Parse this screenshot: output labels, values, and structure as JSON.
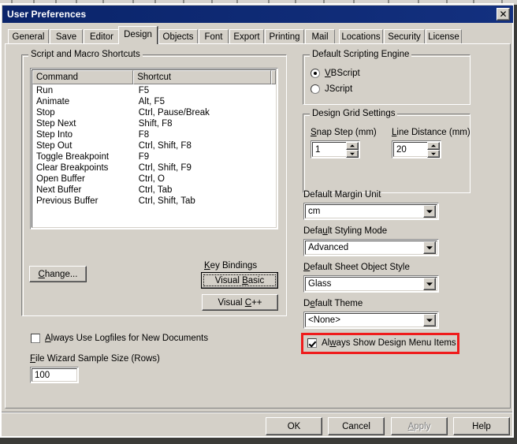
{
  "window": {
    "title": "User Preferences",
    "close_label": "✕",
    "titlebar_color": "#0a246a",
    "face_color": "#d4d0c8"
  },
  "tabs": [
    {
      "label": "General",
      "active": false
    },
    {
      "label": "Save",
      "active": false
    },
    {
      "label": "Editor",
      "active": false
    },
    {
      "label": "Design",
      "active": true
    },
    {
      "label": "Objects",
      "active": false
    },
    {
      "label": "Font",
      "active": false
    },
    {
      "label": "Export",
      "active": false
    },
    {
      "label": "Printing",
      "active": false
    },
    {
      "label": "Mail",
      "active": false
    },
    {
      "label": "Locations",
      "active": false
    },
    {
      "label": "Security",
      "active": false
    },
    {
      "label": "License",
      "active": false
    }
  ],
  "shortcuts_group": {
    "title": "Script and Macro Shortcuts",
    "columns": [
      "Command",
      "Shortcut",
      ""
    ],
    "rows": [
      {
        "command": "Run",
        "shortcut": "F5"
      },
      {
        "command": "Animate",
        "shortcut": "Alt, F5"
      },
      {
        "command": "Stop",
        "shortcut": "Ctrl, Pause/Break"
      },
      {
        "command": "Step Next",
        "shortcut": "Shift, F8"
      },
      {
        "command": "Step Into",
        "shortcut": "F8"
      },
      {
        "command": "Step Out",
        "shortcut": "Ctrl, Shift, F8"
      },
      {
        "command": "Toggle Breakpoint",
        "shortcut": "F9"
      },
      {
        "command": "Clear Breakpoints",
        "shortcut": "Ctrl, Shift, F9"
      },
      {
        "command": "Open Buffer",
        "shortcut": "Ctrl, O"
      },
      {
        "command": "Next Buffer",
        "shortcut": "Ctrl, Tab"
      },
      {
        "command": "Previous Buffer",
        "shortcut": "Ctrl, Shift, Tab"
      }
    ],
    "change_button": "Change...",
    "key_bindings_label": "Key Bindings",
    "visual_basic_button": "Visual Basic",
    "visual_cpp_button": "Visual C++"
  },
  "logfiles": {
    "checkbox_label": "Always Use Logfiles for New Documents",
    "checked": false
  },
  "file_wizard": {
    "label": "File Wizard Sample Size (Rows)",
    "value": "100"
  },
  "scripting_engine": {
    "title": "Default Scripting Engine",
    "options": [
      {
        "label": "VBScript",
        "selected": true
      },
      {
        "label": "JScript",
        "selected": false
      }
    ]
  },
  "design_grid": {
    "title": "Design Grid Settings",
    "snap_step_label": "Snap Step (mm)",
    "snap_step_value": "1",
    "line_distance_label": "Line Distance (mm)",
    "line_distance_value": "20"
  },
  "dropdowns": [
    {
      "label": "Default Margin Unit",
      "value": "cm"
    },
    {
      "label": "Default Styling Mode",
      "value": "Advanced"
    },
    {
      "label": "Default Sheet Object Style",
      "value": "Glass"
    },
    {
      "label": "Default Theme",
      "value": "<None>"
    }
  ],
  "design_menu": {
    "checkbox_label": "Always Show Design Menu Items",
    "checked": true,
    "highlight_color": "#ef1c1c"
  },
  "footer": {
    "ok": "OK",
    "cancel": "Cancel",
    "apply": "Apply",
    "apply_disabled": true,
    "help": "Help"
  }
}
